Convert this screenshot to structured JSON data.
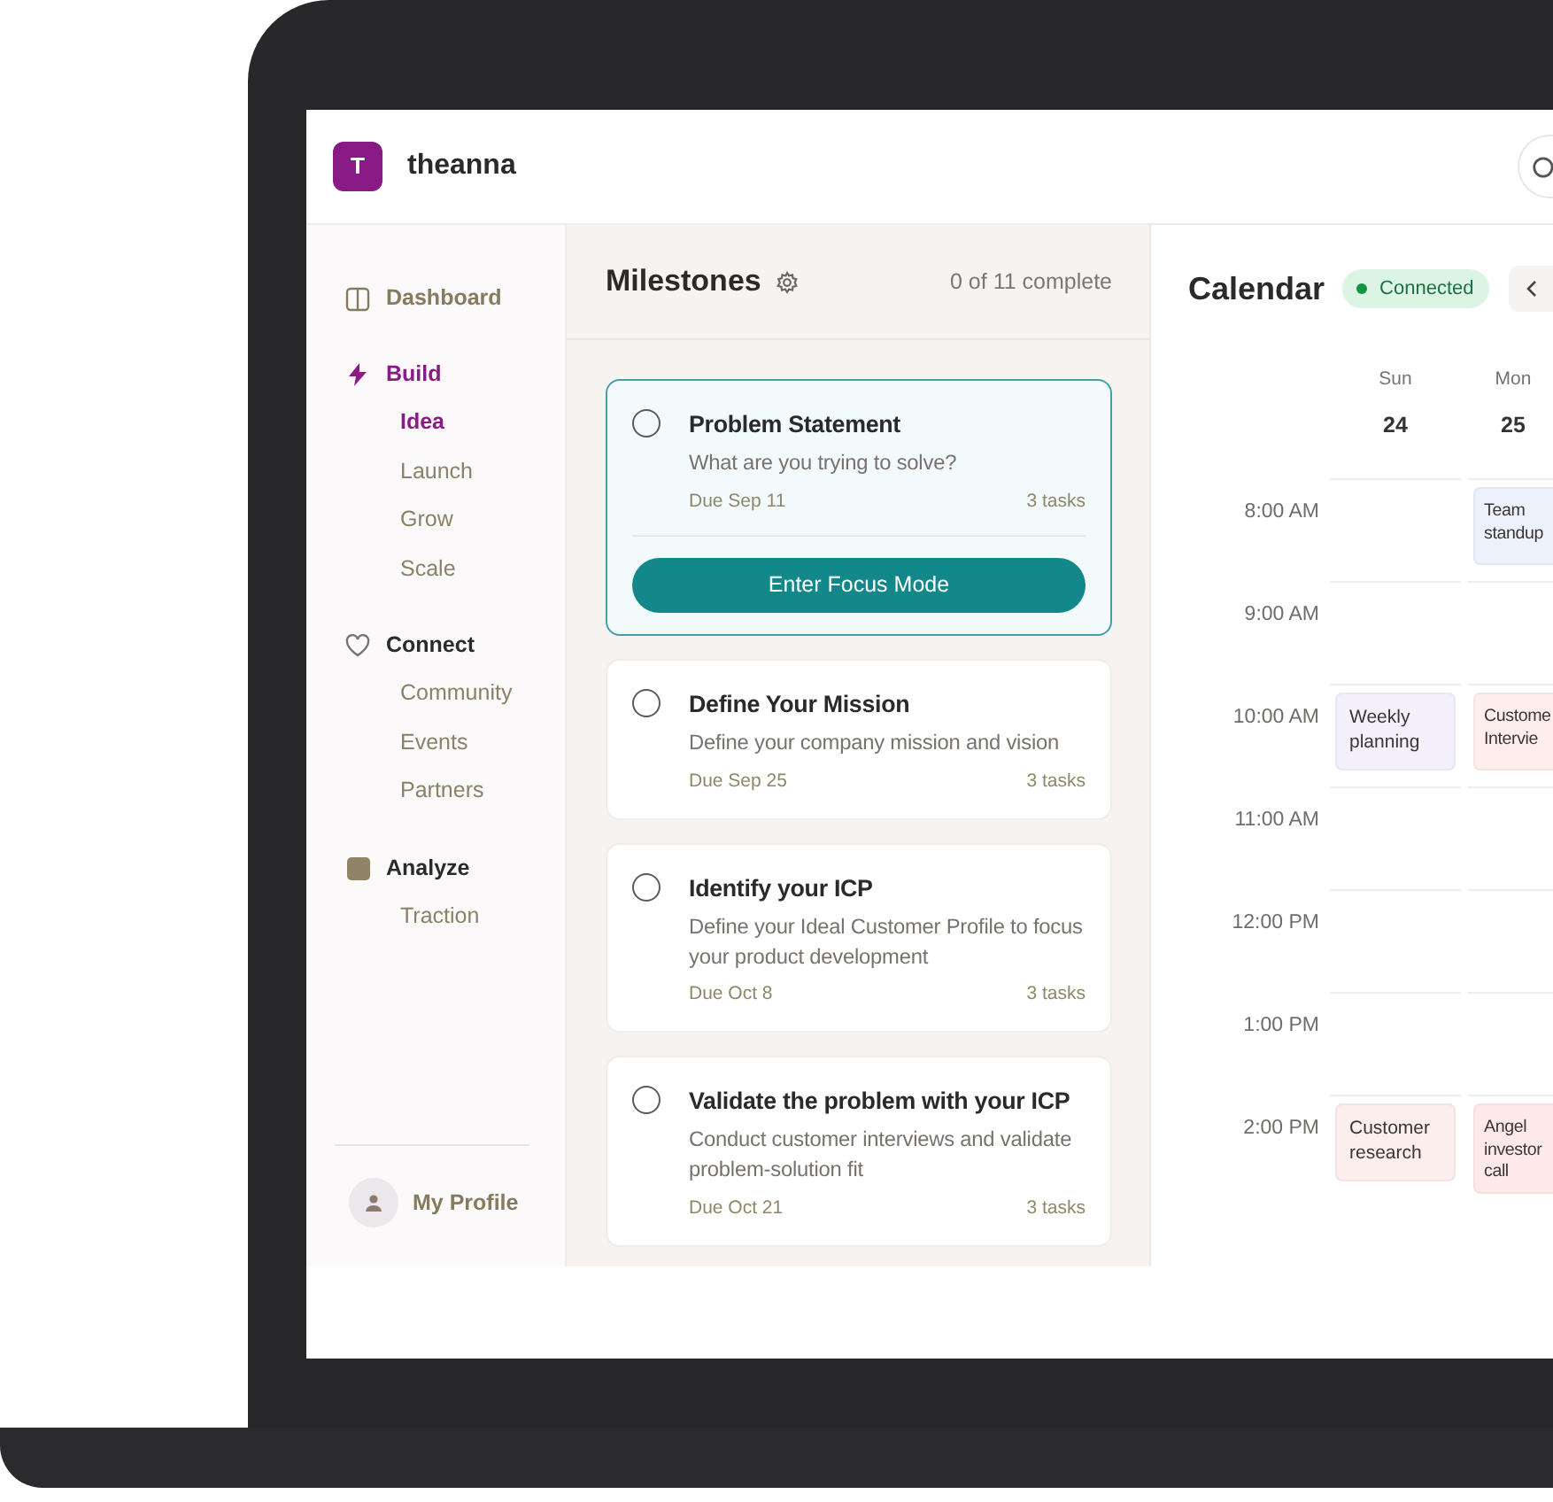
{
  "app": {
    "logo_letter": "T",
    "name": "theanna"
  },
  "sidebar": {
    "items": [
      {
        "kind": "link",
        "label": "Dashboard",
        "selected": false
      },
      {
        "kind": "section",
        "label": "Build",
        "selected": true,
        "children": [
          {
            "label": "Idea",
            "selected": true
          },
          {
            "label": "Launch",
            "selected": false
          },
          {
            "label": "Grow",
            "selected": false
          },
          {
            "label": "Scale",
            "selected": false
          }
        ]
      },
      {
        "kind": "section",
        "label": "Connect",
        "selected": false,
        "children": [
          {
            "label": "Community",
            "selected": false
          },
          {
            "label": "Events",
            "selected": false
          },
          {
            "label": "Partners",
            "selected": false
          }
        ]
      },
      {
        "kind": "section",
        "label": "Analyze",
        "selected": false,
        "children": [
          {
            "label": "Traction",
            "selected": false
          }
        ]
      }
    ],
    "profile": {
      "label": "My Profile"
    }
  },
  "milestones": {
    "title": "Milestones",
    "progress": "0 of 11 complete",
    "cards": [
      {
        "title": "Problem Statement",
        "description": "What are you trying to solve?",
        "due": "Due Sep 11",
        "tasks": "3 tasks",
        "checked": false,
        "selected": true,
        "action": "Enter Focus Mode"
      },
      {
        "title": "Define Your Mission",
        "description": "Define your company mission and vision",
        "due": "Due Sep 25",
        "tasks": "3 tasks",
        "checked": false,
        "selected": false
      },
      {
        "title": "Identify your ICP",
        "description": "Define your Ideal Customer Profile to focus your product development",
        "due": "Due Oct 8",
        "tasks": "3 tasks",
        "checked": false,
        "selected": false
      },
      {
        "title": "Validate the problem with your ICP",
        "description": "Conduct customer interviews and validate problem-solution fit",
        "due": "Due Oct 21",
        "tasks": "3 tasks",
        "checked": false,
        "selected": false
      }
    ]
  },
  "calendar": {
    "title": "Calendar",
    "status": "Connected",
    "days": [
      {
        "name": "Sun",
        "date": "24"
      },
      {
        "name": "Mon",
        "date": "25"
      }
    ],
    "rows": [
      {
        "time": "8:00 AM",
        "cells": [
          {},
          {
            "title": "Team standup",
            "color": "#edf1fb"
          }
        ]
      },
      {
        "time": "9:00 AM",
        "cells": [
          {},
          {}
        ]
      },
      {
        "time": "10:00 AM",
        "cells": [
          {
            "title": "Weekly planning",
            "color": "#f3f0fc"
          },
          {
            "title": "Custome Intervie",
            "color": "#fdeeed"
          }
        ]
      },
      {
        "time": "11:00 AM",
        "cells": [
          {},
          {}
        ]
      },
      {
        "time": "12:00 PM",
        "cells": [
          {},
          {}
        ]
      },
      {
        "time": "1:00 PM",
        "cells": [
          {},
          {}
        ]
      },
      {
        "time": "2:00 PM",
        "cells": [
          {
            "title": "Customer research",
            "color": "#fdeeee"
          },
          {
            "title": "Angel investor call",
            "color": "#fde9ea"
          }
        ]
      }
    ]
  }
}
